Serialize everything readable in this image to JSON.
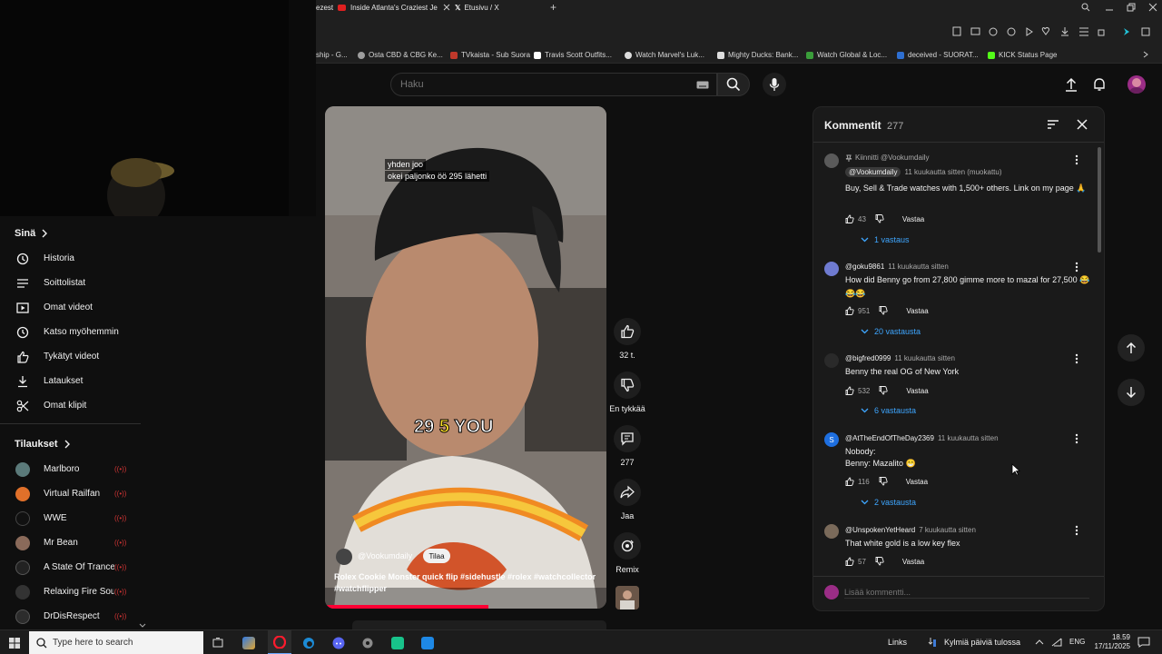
{
  "browser": {
    "tabs": [
      {
        "title": "ezest M"
      },
      {
        "title": "Inside Atlanta's Craziest Je"
      },
      {
        "title": "Etusivu / X"
      }
    ],
    "new_tab_label": "+",
    "bookmarks": [
      {
        "label": "ship - G...",
        "color": "#888888"
      },
      {
        "label": "Osta CBD & CBG Ke...",
        "color": "#9e9e9e"
      },
      {
        "label": "TVkaista - Sub Suora",
        "color": "#c0392b"
      },
      {
        "label": "Travis Scott Outfits...",
        "color": "#ffffff"
      },
      {
        "label": "Watch Marvel's Luk...",
        "color": "#dddddd"
      },
      {
        "label": "Mighty Ducks: Bank...",
        "color": "#dddddd"
      },
      {
        "label": "Watch Global & Loc...",
        "color": "#3a9d3a"
      },
      {
        "label": "deceived - SUORAT...",
        "color": "#2e6fd1"
      },
      {
        "label": "KICK Status Page",
        "color": "#2a2a2a"
      }
    ]
  },
  "header": {
    "search_placeholder": "Haku"
  },
  "sidebar": {
    "you_title": "Sinä",
    "you_items": [
      {
        "label": "Historia",
        "icon": "history-icon"
      },
      {
        "label": "Soittolistat",
        "icon": "playlist-icon"
      },
      {
        "label": "Omat videot",
        "icon": "video-icon"
      },
      {
        "label": "Katso myöhemmin",
        "icon": "clock-icon"
      },
      {
        "label": "Tykätyt videot",
        "icon": "thumb-up-icon"
      },
      {
        "label": "Lataukset",
        "icon": "download-icon"
      },
      {
        "label": "Omat klipit",
        "icon": "scissors-icon"
      }
    ],
    "subs_title": "Tilaukset",
    "subs": [
      {
        "label": "Marlboro",
        "color": "#5b7a7a"
      },
      {
        "label": "Virtual Railfan",
        "color": "#e0702a"
      },
      {
        "label": "WWE",
        "color": "#111111"
      },
      {
        "label": "Mr Bean",
        "color": "#8a6a5a"
      },
      {
        "label": "A State Of Trance",
        "color": "#222222"
      },
      {
        "label": "Relaxing Fire Sou...",
        "color": "#333333"
      },
      {
        "label": "DrDisRespect",
        "color": "#2c2c2c"
      }
    ],
    "live_glyph": "((•))"
  },
  "video": {
    "caption_line1": "yhden joo",
    "caption_line2": "okei paljonko öö 295 lähetti",
    "overlay_a": "29",
    "overlay_b": "5",
    "overlay_c": "YOU",
    "channel": "@Vookumdaily",
    "subscribe_label": "Tilaa",
    "description": "Rolex Cookie Monster quick flip #sidehustle #rolex #watchcollector #watchflipper"
  },
  "actions": {
    "likes": "32 t.",
    "dislike": "En tykkää",
    "comments": "277",
    "share": "Jaa",
    "remix": "Remix"
  },
  "comments_panel": {
    "title": "Kommentit",
    "count": "277",
    "add_placeholder": "Lisää kommentti...",
    "reply_label": "Vastaa",
    "pinned_label": "Kiinnitti @Vookumdaily",
    "items": [
      {
        "author": "@Vookumdaily",
        "time": "11 kuukautta sitten (muokattu)",
        "text": "Buy, Sell & Trade watches with 1,500+ others. Link on my page 🙏",
        "likes": "43",
        "replies": "1 vastaus",
        "color": "#5a5a5a"
      },
      {
        "author": "@goku9861",
        "time": "11 kuukautta sitten",
        "text": "How did Benny go from 27,800 gimme more to mazal for 27,500 😂😂😂",
        "likes": "951",
        "replies": "20 vastausta",
        "color": "#6f7bd1"
      },
      {
        "author": "@bigfred0999",
        "time": "11 kuukautta sitten",
        "text": "Benny the real OG of New York",
        "likes": "532",
        "replies": "6 vastausta",
        "color": "#2a2a2a"
      },
      {
        "author": "@AtTheEndOfTheDay2369",
        "time": "11 kuukautta sitten",
        "text": "Nobody:",
        "text2": "Benny: Mazalito 😁",
        "likes": "116",
        "replies": "2 vastausta",
        "color": "#1e6fe0",
        "initial": "S"
      },
      {
        "author": "@UnspokenYetHeard",
        "time": "7 kuukautta sitten",
        "text": "That white gold is a low key flex",
        "likes": "57",
        "color": "#7a6a5a"
      }
    ]
  },
  "taskbar": {
    "search_placeholder": "Type here to search",
    "links": "Links",
    "weather": "Kylmiä päiviä tulossa",
    "lang": "ENG",
    "time": "18.59",
    "date": "17/11/2025"
  }
}
